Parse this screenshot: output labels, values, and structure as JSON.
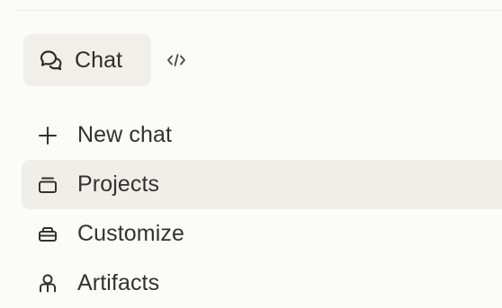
{
  "mode_switch": {
    "chat_label": "Chat",
    "chat_icon": "chat-bubbles-icon",
    "code_icon": "code-icon"
  },
  "nav": {
    "items": [
      {
        "label": "New chat",
        "icon": "plus-icon",
        "active": false
      },
      {
        "label": "Projects",
        "icon": "projects-icon",
        "active": true
      },
      {
        "label": "Customize",
        "icon": "customize-icon",
        "active": false
      },
      {
        "label": "Artifacts",
        "icon": "artifacts-icon",
        "active": false
      }
    ]
  },
  "colors": {
    "background": "#fbfbf9",
    "active_background": "#efeee9",
    "text": "#2f2d2a"
  }
}
